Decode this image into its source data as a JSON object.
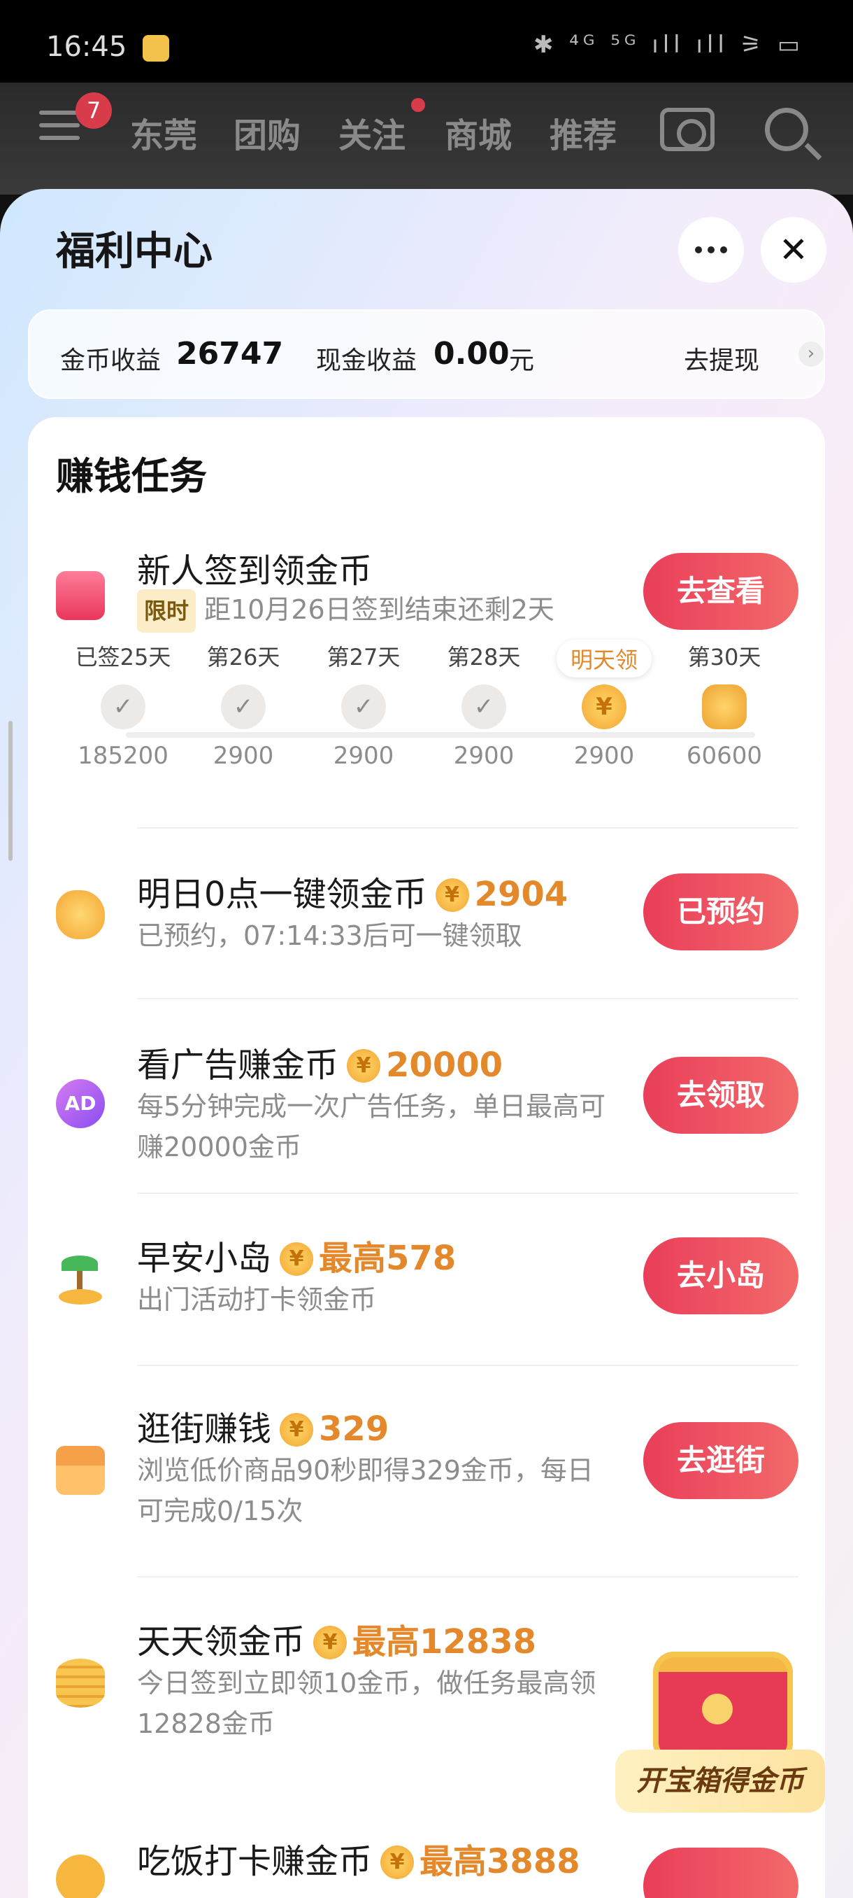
{
  "status_bar": {
    "time": "16:45",
    "system_icons": "✱ ⁴ᴳ ⁵ᴳ ıll ıll ⚞ ▭"
  },
  "top_nav": {
    "badge_count": "7",
    "tabs": [
      "东莞",
      "团购",
      "关注",
      "商城",
      "推荐"
    ]
  },
  "sheet": {
    "title": "福利中心",
    "close_label": "✕"
  },
  "earnings": {
    "coin_label": "金币收益",
    "coin_value": "26747",
    "cash_label": "现金收益",
    "cash_value": "0.00",
    "cash_unit": "元",
    "withdraw_label": "去提现",
    "chevron": "›"
  },
  "tasks_section": {
    "title": "赚钱任务"
  },
  "tasks": [
    {
      "icon": "calendar-check-icon",
      "title": "新人签到领金币",
      "tag": "限时",
      "desc": "距10月26日签到结束还剩2天",
      "button": "去查看"
    },
    {
      "icon": "piggy-bank-icon",
      "title": "明日0点一键领金币",
      "amount": "2904",
      "desc": "已预约，07:14:33后可一键领取",
      "button": "已预约"
    },
    {
      "icon": "ad-icon",
      "title": "看广告赚金币",
      "amount": "20000",
      "desc": "每5分钟完成一次广告任务，单日最高可赚20000金币",
      "button": "去领取"
    },
    {
      "icon": "palm-island-icon",
      "title": "早安小岛",
      "amount": "最高578",
      "desc": "出门活动打卡领金币",
      "button": "去小岛"
    },
    {
      "icon": "shop-icon",
      "title": "逛街赚钱",
      "amount": "329",
      "desc": "浏览低价商品90秒即得329金币，每日可完成0/15次",
      "button": "去逛街"
    },
    {
      "icon": "coin-stack-icon",
      "title": "天天领金币",
      "amount": "最高12838",
      "desc": "今日签到立即领10金币，做任务最高领12828金币",
      "button": "开宝箱得金币"
    },
    {
      "icon": "meal-icon",
      "title": "吃饭打卡赚金币",
      "amount": "最高3888"
    }
  ],
  "checkin_calendar": [
    {
      "label": "已签25天",
      "amount": "185200",
      "state": "done",
      "mark": "✓"
    },
    {
      "label": "第26天",
      "amount": "2900",
      "state": "done",
      "mark": "✓"
    },
    {
      "label": "第27天",
      "amount": "2900",
      "state": "done",
      "mark": "✓"
    },
    {
      "label": "第28天",
      "amount": "2900",
      "state": "done",
      "mark": "✓"
    },
    {
      "label": "明天领",
      "amount": "2900",
      "state": "tomorrow",
      "mark": "¥"
    },
    {
      "label": "第30天",
      "amount": "60600",
      "state": "final",
      "mark": ""
    }
  ],
  "coin_symbol": "¥",
  "colors": {
    "button": "#ea3e5a",
    "amount": "#e4892b",
    "badge": "#d83b4a"
  }
}
